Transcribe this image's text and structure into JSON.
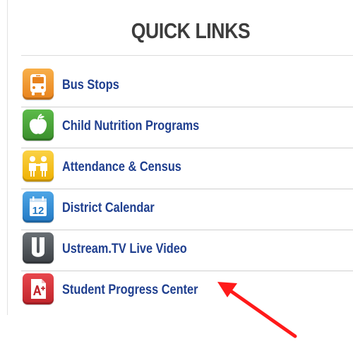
{
  "quick_links": {
    "title": "QUICK LINKS",
    "items": [
      {
        "label": "Bus Stops",
        "icon": "bus-icon",
        "color": "#f39a2e"
      },
      {
        "label": "Child Nutrition Programs",
        "icon": "apple-icon",
        "color": "#4aa538"
      },
      {
        "label": "Attendance & Census",
        "icon": "children-icon",
        "color": "#f5c21b"
      },
      {
        "label": "District Calendar",
        "icon": "calendar-icon",
        "color": "#2f8ed3"
      },
      {
        "label": "Ustream.TV Live Video",
        "icon": "ustream-icon",
        "color": "#4e5358"
      },
      {
        "label": "Student Progress Center",
        "icon": "grade-paper-icon",
        "color": "#d8333a"
      }
    ]
  },
  "calendar_icon_text": "12",
  "annotation": {
    "color": "#ff1a1a"
  }
}
